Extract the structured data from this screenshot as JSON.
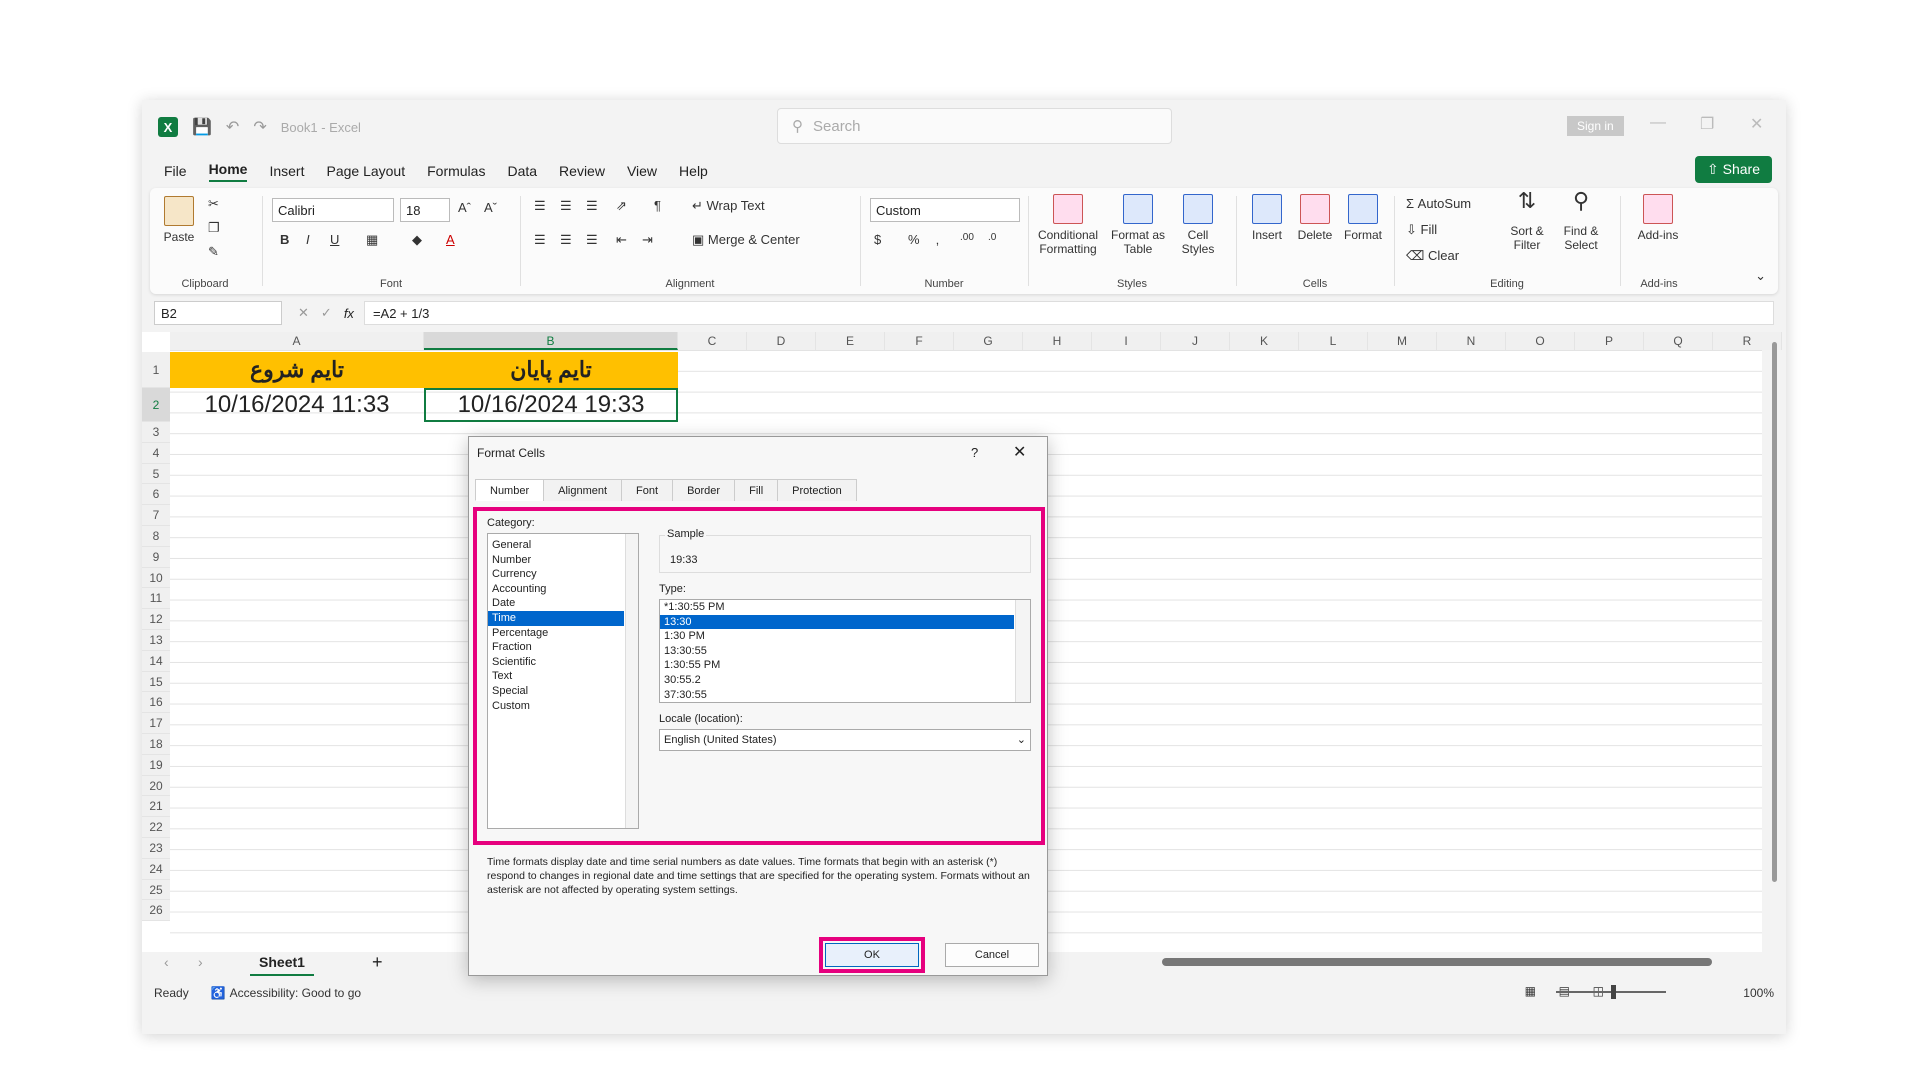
{
  "titlebar": {
    "app_icon": "X",
    "title": "Book1 - Excel",
    "search_placeholder": "Search",
    "sign_in": "Sign in"
  },
  "tabs": [
    "File",
    "Home",
    "Insert",
    "Page Layout",
    "Formulas",
    "Data",
    "Review",
    "View",
    "Help"
  ],
  "active_tab": "Home",
  "share_label": "Share",
  "ribbon": {
    "clipboard": {
      "label": "Clipboard",
      "paste": "Paste"
    },
    "font": {
      "label": "Font",
      "family": "Calibri",
      "size": "18"
    },
    "alignment": {
      "label": "Alignment",
      "wrap_text": "Wrap Text",
      "merge_center": "Merge & Center"
    },
    "number": {
      "label": "Number",
      "format": "Custom"
    },
    "styles": {
      "label": "Styles",
      "conditional": "Conditional Formatting",
      "format_table": "Format as Table",
      "cell_styles": "Cell Styles"
    },
    "cells": {
      "label": "Cells",
      "insert": "Insert",
      "delete": "Delete",
      "format": "Format"
    },
    "editing": {
      "label": "Editing",
      "autosum": "AutoSum",
      "fill": "Fill",
      "clear": "Clear",
      "sort_filter": "Sort & Filter",
      "find_select": "Find & Select"
    },
    "addins": {
      "label": "Add-ins",
      "addins": "Add-ins"
    }
  },
  "formula_bar": {
    "name_box": "B2",
    "formula": "=A2 + 1/3"
  },
  "columns": [
    "A",
    "B",
    "C",
    "D",
    "E",
    "F",
    "G",
    "H",
    "I",
    "J",
    "K",
    "L",
    "M",
    "N",
    "O",
    "P",
    "Q",
    "R"
  ],
  "rows": [
    "1",
    "2",
    "3",
    "4",
    "5",
    "6",
    "7",
    "8",
    "9",
    "10",
    "11",
    "12",
    "13",
    "14",
    "15",
    "16",
    "17",
    "18",
    "19",
    "20",
    "21",
    "22",
    "23",
    "24",
    "25",
    "26"
  ],
  "cells": {
    "a1": "تایم شروع",
    "b1": "تایم پایان",
    "a2": "10/16/2024 11:33",
    "b2": "10/16/2024 19:33"
  },
  "sheet_tab": "Sheet1",
  "status": {
    "ready": "Ready",
    "accessibility": "Accessibility: Good to go",
    "zoom": "100%"
  },
  "dialog": {
    "title": "Format Cells",
    "help": "?",
    "tabs": [
      "Number",
      "Alignment",
      "Font",
      "Border",
      "Fill",
      "Protection"
    ],
    "category_label": "Category:",
    "categories": [
      "General",
      "Number",
      "Currency",
      "Accounting",
      "Date",
      "Time",
      "Percentage",
      "Fraction",
      "Scientific",
      "Text",
      "Special",
      "Custom"
    ],
    "selected_category": "Time",
    "sample_label": "Sample",
    "sample_value": "19:33",
    "type_label": "Type:",
    "types": [
      "*1:30:55 PM",
      "13:30",
      "1:30 PM",
      "13:30:55",
      "1:30:55 PM",
      "30:55.2",
      "37:30:55"
    ],
    "selected_type": "13:30",
    "locale_label": "Locale (location):",
    "locale_value": "English (United States)",
    "description": "Time formats display date and time serial numbers as date values.  Time formats that begin with an asterisk (*) respond to changes in regional date and time settings that are specified for the operating system. Formats without an asterisk are not affected by operating system settings.",
    "ok": "OK",
    "cancel": "Cancel"
  },
  "colors": {
    "accent": "#107c41",
    "header_fill": "#ffc000",
    "highlight": "#e6007e",
    "selection": "#0066cc"
  }
}
